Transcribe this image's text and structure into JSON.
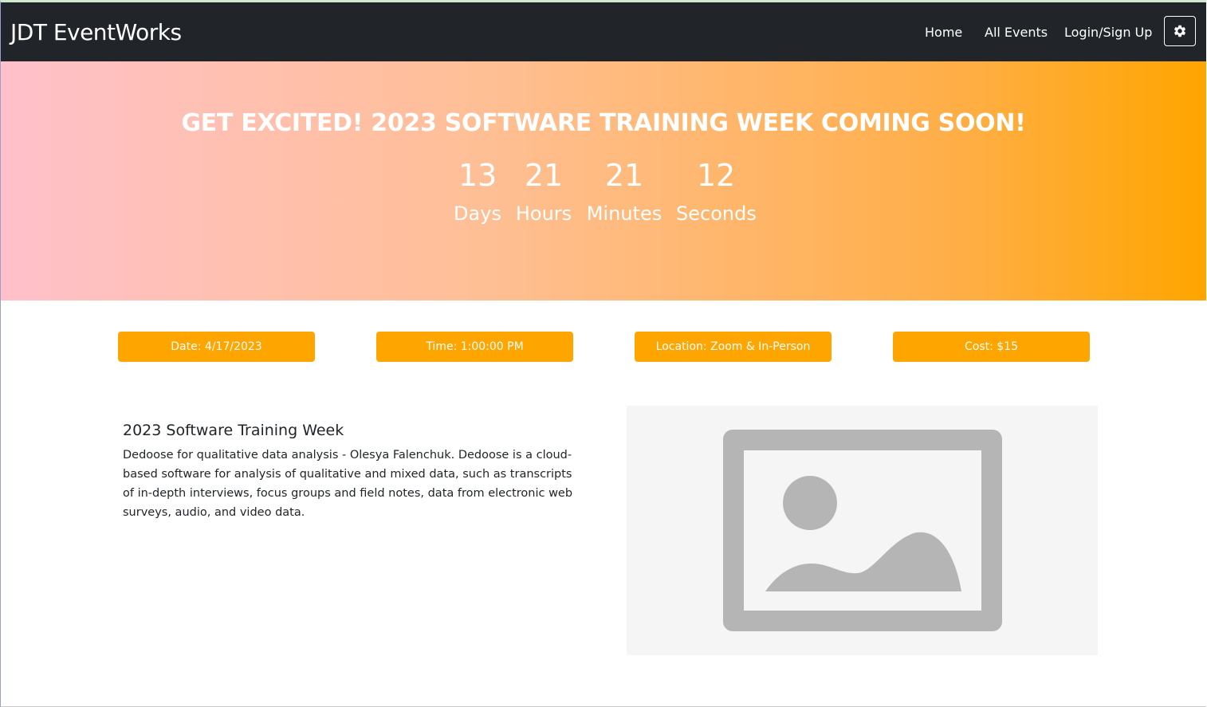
{
  "navbar": {
    "brand": "JDT EventWorks",
    "links": {
      "home": "Home",
      "all_events": "All Events",
      "login": "Login/Sign Up"
    },
    "settings_icon": "gear-icon"
  },
  "hero": {
    "title": "GET EXCITED! 2023 SOFTWARE TRAINING WEEK COMING SOON!",
    "countdown": {
      "days": {
        "value": "13",
        "label": "Days"
      },
      "hours": {
        "value": "21",
        "label": "Hours"
      },
      "minutes": {
        "value": "21",
        "label": "Minutes"
      },
      "seconds": {
        "value": "12",
        "label": "Seconds"
      }
    },
    "gradient_colors": [
      "#ffc0cb",
      "#ffa500"
    ]
  },
  "info": {
    "date": "Date: 4/17/2023",
    "time": "Time: 1:00:00 PM",
    "location": "Location: Zoom & In-Person",
    "cost": "Cost: $15",
    "button_color": "#ffa500"
  },
  "event": {
    "title": "2023 Software Training Week",
    "description": "Dedoose for qualitative data analysis - Olesya Falenchuk. Dedoose is a cloud-based software for analysis of qualitative and mixed data, such as transcripts of in-depth interviews, focus groups and field notes, data from electronic web surveys, audio, and video data.",
    "image_icon": "image-placeholder-icon"
  }
}
